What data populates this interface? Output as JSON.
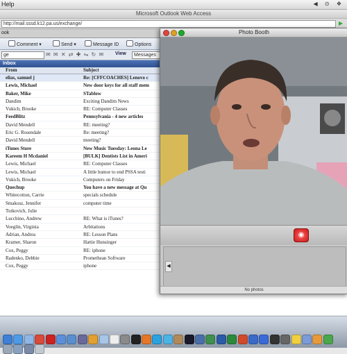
{
  "menubar": {
    "app_menu": "Help",
    "status": "◀ ⊙ ❖"
  },
  "browser": {
    "title": "Microsoft Outlook Web Access",
    "url": "http://mail.sssd.k12.pa.us/exchange/",
    "tab_label": "ook"
  },
  "toolbar": {
    "comment": "Comment",
    "send": "Send",
    "message_id": "Message ID",
    "options": "Options"
  },
  "toolbar2": {
    "folder_select": "ge",
    "view_label": "View",
    "view_select": "Messages"
  },
  "folder": {
    "name": "Inbox"
  },
  "list_header": {
    "from": "From",
    "subject": "Subject"
  },
  "messages": [
    {
      "from": "elias, samuel j",
      "subject": "Re: [CFFCOACHES] Lenovo c",
      "unread": true
    },
    {
      "from": "Lewis, Michael",
      "subject": "New door keys for all staff mem",
      "unread": true
    },
    {
      "from": "Baker, Mike",
      "subject": "STablow",
      "unread": true
    },
    {
      "from": "Dandim",
      "subject": "Exciting Dandim News",
      "unread": false
    },
    {
      "from": "Vukich, Brooke",
      "subject": "RE: Computer Classes",
      "unread": false
    },
    {
      "from": "FeedBlitz",
      "subject": "Pennsylvania - 4 new articles",
      "unread": true
    },
    {
      "from": "David Mendell",
      "subject": "RE: meeting?",
      "unread": false
    },
    {
      "from": "Eric G. Rosendale",
      "subject": "Re: meeting?",
      "unread": false
    },
    {
      "from": "David Mendell",
      "subject": "meeting?",
      "unread": false
    },
    {
      "from": "iTunes Store",
      "subject": "New Music Tuesday: Leona Le",
      "unread": true
    },
    {
      "from": "Kareem H Mcdaniel",
      "subject": "[BULK] Dentists List in Ameri",
      "unread": true
    },
    {
      "from": "Lewis, Michael",
      "subject": "RE: Computer Classes",
      "unread": false
    },
    {
      "from": "Lewis, Michael",
      "subject": "A little humor to end PSSA testi",
      "unread": false
    },
    {
      "from": "Vukich, Brooke",
      "subject": "Computers on Friday",
      "unread": false
    },
    {
      "from": "Quechup",
      "subject": "You have a new message at Qu",
      "unread": true
    },
    {
      "from": "Whitecotton, Carrie",
      "subject": "specials schedule",
      "unread": false
    },
    {
      "from": "Smakosz, Jennifer",
      "subject": "computer time",
      "unread": false
    },
    {
      "from": "Tutkovich, Julie",
      "subject": "",
      "unread": false
    },
    {
      "from": "Lucchino, Andrew",
      "subject": "RE: What is iTunes?",
      "unread": false
    },
    {
      "from": "Voeglin, Virginia",
      "subject": "Arbitations",
      "unread": false
    },
    {
      "from": "Adrian, Andrea",
      "subject": "RE: Lesson Plans",
      "unread": false
    },
    {
      "from": "Kramer, Sharon",
      "subject": "Hattie Hunsinger",
      "unread": false
    },
    {
      "from": "Cox, Peggy",
      "subject": "RE: iphone",
      "unread": false
    },
    {
      "from": "Radenko, Debbie",
      "subject": "Promethean Software",
      "unread": false
    },
    {
      "from": "Cox, Peggy",
      "subject": "iphone",
      "unread": false
    }
  ],
  "photobooth": {
    "title": "Photo Booth",
    "status": "No photos",
    "tray_arrow": "◀"
  },
  "dock": {
    "icons": [
      "finder-icon",
      "safari-icon",
      "mail-icon",
      "ical-icon",
      "photobooth-icon",
      "itunes-icon",
      "iphoto-icon",
      "imovie-icon",
      "garageband-icon",
      "preview-icon",
      "textedit-icon",
      "system-preferences-icon",
      "terminal-icon",
      "firefox-icon",
      "skype-icon",
      "ichat-icon",
      "address-book-icon",
      "dashboard-icon",
      "spaces-icon",
      "timemachine-icon",
      "word-icon",
      "excel-icon",
      "powerpoint-icon",
      "entourage-icon",
      "quicktime-icon",
      "dvd-player-icon",
      "calculator-icon",
      "stickies-icon",
      "keynote-icon",
      "pages-icon",
      "numbers-icon",
      "stack-icon",
      "documents-icon",
      "downloads-icon",
      "trash-icon"
    ],
    "colors": [
      "#3f7fd6",
      "#4d9be8",
      "#8fb6e6",
      "#d84a3a",
      "#c22",
      "#5b8fd9",
      "#5a8fcf",
      "#6a6a9a",
      "#e3a030",
      "#a7c6e8",
      "#eee",
      "#8a8a8a",
      "#222",
      "#e5772a",
      "#2aa2e0",
      "#4cb3e6",
      "#b08a5a",
      "#1a1a2a",
      "#4a6ea8",
      "#3f8f4f",
      "#2b5aa8",
      "#2a8a3a",
      "#d04a2a",
      "#3a6ac8",
      "#3a6ad8",
      "#333",
      "#666",
      "#f0d040",
      "#7a9ad8",
      "#e89a3a",
      "#4aa84a",
      "#9aa8ba",
      "#8aa0c0",
      "#7a8aa8",
      "#c0c8d0"
    ]
  }
}
